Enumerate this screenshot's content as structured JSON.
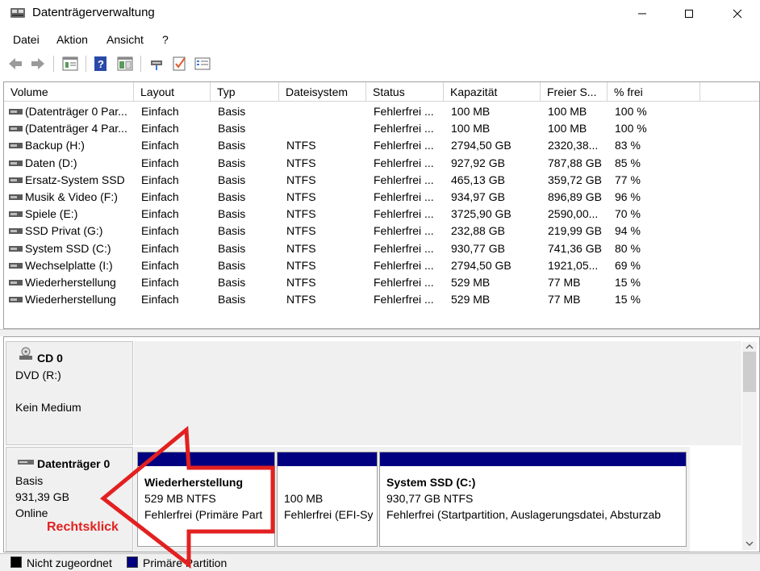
{
  "window": {
    "title": "Datenträgerverwaltung"
  },
  "menu": [
    "Datei",
    "Aktion",
    "Ansicht",
    "?"
  ],
  "toolbar": {
    "icons": [
      "back-icon",
      "forward-icon",
      "properties-icon",
      "help-icon",
      "view-icon",
      "connect-icon",
      "check-icon",
      "list-icon"
    ]
  },
  "volume_table": {
    "columns": [
      "Volume",
      "Layout",
      "Typ",
      "Dateisystem",
      "Status",
      "Kapazität",
      "Freier S...",
      "% frei"
    ],
    "rows": [
      [
        "(Datenträger 0 Par...",
        "Einfach",
        "Basis",
        "",
        "Fehlerfrei ...",
        "100 MB",
        "100 MB",
        "100 %"
      ],
      [
        "(Datenträger 4 Par...",
        "Einfach",
        "Basis",
        "",
        "Fehlerfrei ...",
        "100 MB",
        "100 MB",
        "100 %"
      ],
      [
        "Backup (H:)",
        "Einfach",
        "Basis",
        "NTFS",
        "Fehlerfrei ...",
        "2794,50 GB",
        "2320,38...",
        "83 %"
      ],
      [
        "Daten (D:)",
        "Einfach",
        "Basis",
        "NTFS",
        "Fehlerfrei ...",
        "927,92 GB",
        "787,88 GB",
        "85 %"
      ],
      [
        "Ersatz-System SSD",
        "Einfach",
        "Basis",
        "NTFS",
        "Fehlerfrei ...",
        "465,13 GB",
        "359,72 GB",
        "77 %"
      ],
      [
        "Musik & Video (F:)",
        "Einfach",
        "Basis",
        "NTFS",
        "Fehlerfrei ...",
        "934,97 GB",
        "896,89 GB",
        "96 %"
      ],
      [
        "Spiele (E:)",
        "Einfach",
        "Basis",
        "NTFS",
        "Fehlerfrei ...",
        "3725,90 GB",
        "2590,00...",
        "70 %"
      ],
      [
        "SSD Privat (G:)",
        "Einfach",
        "Basis",
        "NTFS",
        "Fehlerfrei ...",
        "232,88 GB",
        "219,99 GB",
        "94 %"
      ],
      [
        "System SSD (C:)",
        "Einfach",
        "Basis",
        "NTFS",
        "Fehlerfrei ...",
        "930,77 GB",
        "741,36 GB",
        "80 %"
      ],
      [
        "Wechselplatte (I:)",
        "Einfach",
        "Basis",
        "NTFS",
        "Fehlerfrei ...",
        "2794,50 GB",
        "1921,05...",
        "69 %"
      ],
      [
        "Wiederherstellung",
        "Einfach",
        "Basis",
        "NTFS",
        "Fehlerfrei ...",
        "529 MB",
        "77 MB",
        "15 %"
      ],
      [
        "Wiederherstellung",
        "Einfach",
        "Basis",
        "NTFS",
        "Fehlerfrei ...",
        "529 MB",
        "77 MB",
        "15 %"
      ]
    ]
  },
  "cd0": {
    "name": "CD 0",
    "type": "DVD (R:)",
    "status": "Kein Medium"
  },
  "disk0": {
    "name": "Datenträger 0",
    "type": "Basis",
    "size": "931,39 GB",
    "state": "Online",
    "partitions": [
      {
        "title": "Wiederherstellung",
        "line1": "529 MB NTFS",
        "line2": "Fehlerfrei (Primäre Part"
      },
      {
        "title": "",
        "line1": "100 MB",
        "line2": "Fehlerfrei (EFI-Sy"
      },
      {
        "title": "System SSD  (C:)",
        "line1": "930,77 GB NTFS",
        "line2": "Fehlerfrei (Startpartition, Auslagerungsdatei, Absturzab"
      }
    ]
  },
  "legend": {
    "items": [
      {
        "label": "Nicht zugeordnet",
        "color": "#000000"
      },
      {
        "label": "Primäre Partition",
        "color": "#000080"
      }
    ]
  },
  "annotation": {
    "text": "Rechtsklick",
    "color": "#e32020"
  }
}
